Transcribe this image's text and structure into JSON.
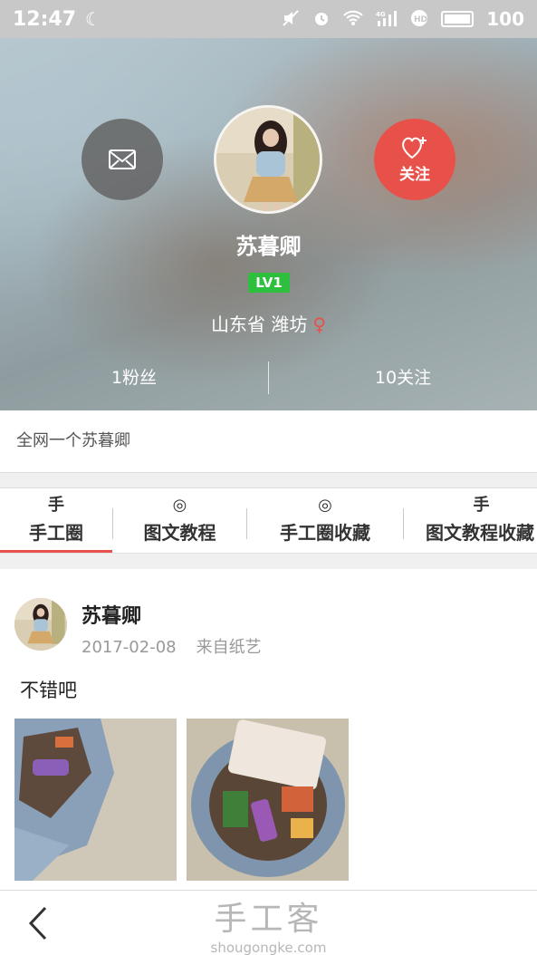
{
  "status_bar": {
    "time": "12:47",
    "battery": "100",
    "network": "4G",
    "icons": [
      "moon-icon",
      "mute-icon",
      "alarm-icon",
      "wifi-icon",
      "signal-icon",
      "hd-icon",
      "battery-icon"
    ]
  },
  "profile": {
    "username": "苏暮卿",
    "level": "LV1",
    "location": "山东省 潍坊",
    "gender_symbol": "♀",
    "follow_label": "关注",
    "fans": "1粉丝",
    "following": "10关注",
    "signature": "全网一个苏暮卿"
  },
  "tabs": [
    {
      "label": "手工圈",
      "icon": "手",
      "active": true
    },
    {
      "label": "图文教程",
      "icon": "◎",
      "active": false
    },
    {
      "label": "手工圈收藏",
      "icon": "◎",
      "active": false
    },
    {
      "label": "图文教程收藏",
      "icon": "手",
      "active": false
    }
  ],
  "post": {
    "author": "苏暮卿",
    "date": "2017-02-08",
    "source": "来自纸艺",
    "text": "不错吧"
  },
  "bottom": {
    "watermark_cn": "手工客",
    "watermark_en": "shougongke.com"
  },
  "colors": {
    "accent_red": "#e8504a",
    "level_green": "#2fbf3e",
    "status_bar_gray": "#c8c8c8"
  }
}
